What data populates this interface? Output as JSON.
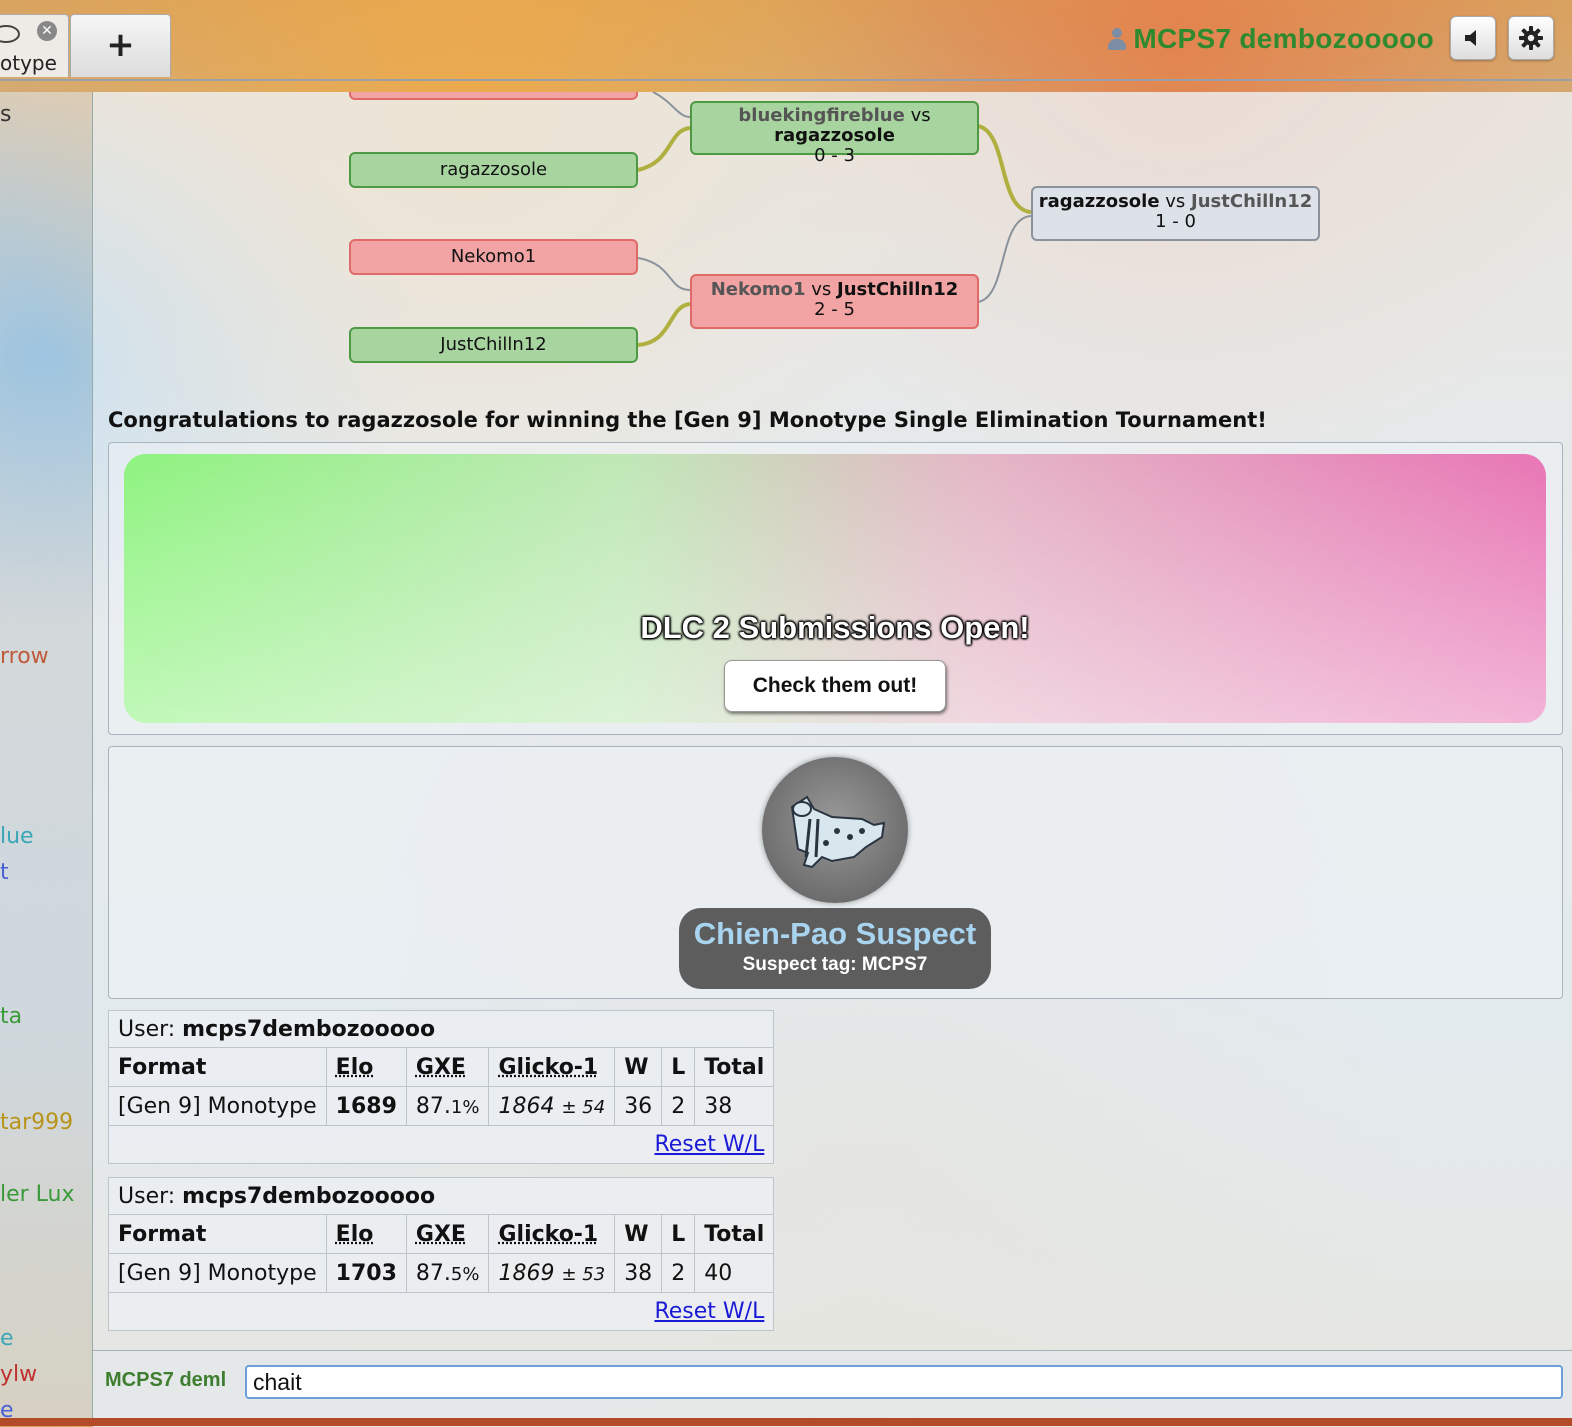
{
  "topbar": {
    "room_tab_label": "otype",
    "new_tab_label": "+",
    "username": "MCPS7 dembozooooo",
    "close_icon": "close-icon",
    "sound_icon": "sound-icon",
    "settings_icon": "gear-icon"
  },
  "sidebar": {
    "items": [
      {
        "label": "s",
        "color": "#333333"
      },
      {
        "label": "rrow",
        "color": "#c05a3a"
      },
      {
        "label": "lue",
        "color": "#3aa6b8"
      },
      {
        "label": "t",
        "color": "#4a5fd6"
      },
      {
        "label": "ta",
        "color": "#3a9a3a"
      },
      {
        "label": "tar999",
        "color": "#b8941a"
      },
      {
        "label": "ler Lux",
        "color": "#3a9a3a"
      },
      {
        "label": "e",
        "color": "#3aa6b8"
      },
      {
        "label": "ylw",
        "color": "#c03030"
      },
      {
        "label": "e",
        "color": "#4a5fd6"
      }
    ]
  },
  "bracket": {
    "nodes": {
      "ragazzosole": "ragazzosole",
      "nekomo1": "Nekomo1",
      "justchilln12": "JustChilln12",
      "m1_p1": "bluekingfireblue",
      "m1_vs": "vs",
      "m1_p2": "ragazzosole",
      "m1_score": "0 - 3",
      "m2_p1": "Nekomo1",
      "m2_vs": "vs",
      "m2_p2": "JustChilln12",
      "m2_score": "2 - 5",
      "final_p1": "ragazzosole",
      "final_vs": "vs",
      "final_p2": "JustChilln12",
      "final_score": "1 - 0"
    },
    "colors": {
      "win": "#a8d4a0",
      "lose": "#f2a3a3",
      "neutral": "#dde2e8",
      "link_win": "#b0b040",
      "link_lose": "#8a929c"
    }
  },
  "congrats": "Congratulations to ragazzosole for winning the [Gen 9] Monotype Single Elimination Tournament!",
  "banner": {
    "title": "DLC 2 Submissions Open!",
    "button": "Check them out!"
  },
  "suspect": {
    "title": "Chien-Pao Suspect",
    "subtitle": "Suspect tag: MCPS7",
    "sprite_icon": "chien-pao-sprite"
  },
  "rankings": [
    {
      "user_label": "User:",
      "user": "mcps7dembozooooo",
      "headers": [
        "Format",
        "Elo",
        "GXE",
        "Glicko-1",
        "W",
        "L",
        "Total"
      ],
      "format": "[Gen 9] Monotype",
      "elo": "1689",
      "gxe_int": "87.",
      "gxe_dec": "1%",
      "glicko": "1864",
      "glicko_pm": "± 54",
      "w": "36",
      "l": "2",
      "total": "38",
      "reset": "Reset W/L"
    },
    {
      "user_label": "User:",
      "user": "mcps7dembozooooo",
      "headers": [
        "Format",
        "Elo",
        "GXE",
        "Glicko-1",
        "W",
        "L",
        "Total"
      ],
      "format": "[Gen 9] Monotype",
      "elo": "1703",
      "gxe_int": "87.",
      "gxe_dec": "5%",
      "glicko": "1869",
      "glicko_pm": "± 53",
      "w": "38",
      "l": "2",
      "total": "40",
      "reset": "Reset W/L"
    }
  ],
  "chat": {
    "name": "MCPS7 deml",
    "input_value": "chait"
  }
}
